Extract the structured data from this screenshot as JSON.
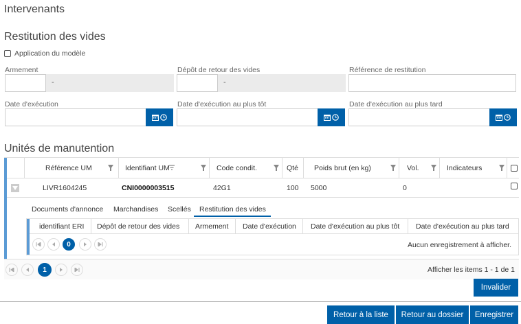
{
  "header": {
    "title": "Intervenants"
  },
  "restitution": {
    "title": "Restitution des vides",
    "apply_model_label": "Application du modèle",
    "armement_label": "Armement",
    "armement_value": "-",
    "depot_label": "Dépôt de retour des vides",
    "depot_value": "-",
    "reference_label": "Référence de restitution",
    "date_exec_label": "Date d'exécution",
    "date_exec_tot_label": "Date d'exécution au plus tôt",
    "date_exec_tard_label": "Date d'exécution au plus tard"
  },
  "um": {
    "title": "Unités de manutention",
    "columns": [
      "Référence UM",
      "Identifiant UM",
      "Code condit.",
      "Qté",
      "Poids brut (en kg)",
      "Vol.",
      "Indicateurs"
    ],
    "row": {
      "reference": "LIVR1604245",
      "identifiant": "CNI0000003515",
      "code": "42G1",
      "qte": "100",
      "poids": "5000",
      "vol": "0",
      "indicateurs": ""
    },
    "tabs": [
      "Documents d'annonce",
      "Marchandises",
      "Scellés",
      "Restitution des vides"
    ],
    "active_tab": "Restitution des vides",
    "sub_columns": [
      "identifiant ERI",
      "Dépôt de retour des vides",
      "Armement",
      "Date d'exécution",
      "Date d'exécution au plus tôt",
      "Date d'exécution au plus tard"
    ],
    "sub_page": "0",
    "sub_empty": "Aucun enregistrement à afficher.",
    "page": "1",
    "items_info": "Afficher les items 1 - 1 de 1"
  },
  "actions": {
    "invalider": "Invalider",
    "retour_liste": "Retour à la liste",
    "retour_dossier": "Retour au dossier",
    "enregistrer": "Enregistrer"
  },
  "colors": {
    "primary": "#0060a8",
    "accent_bar": "#5b9bd5"
  }
}
